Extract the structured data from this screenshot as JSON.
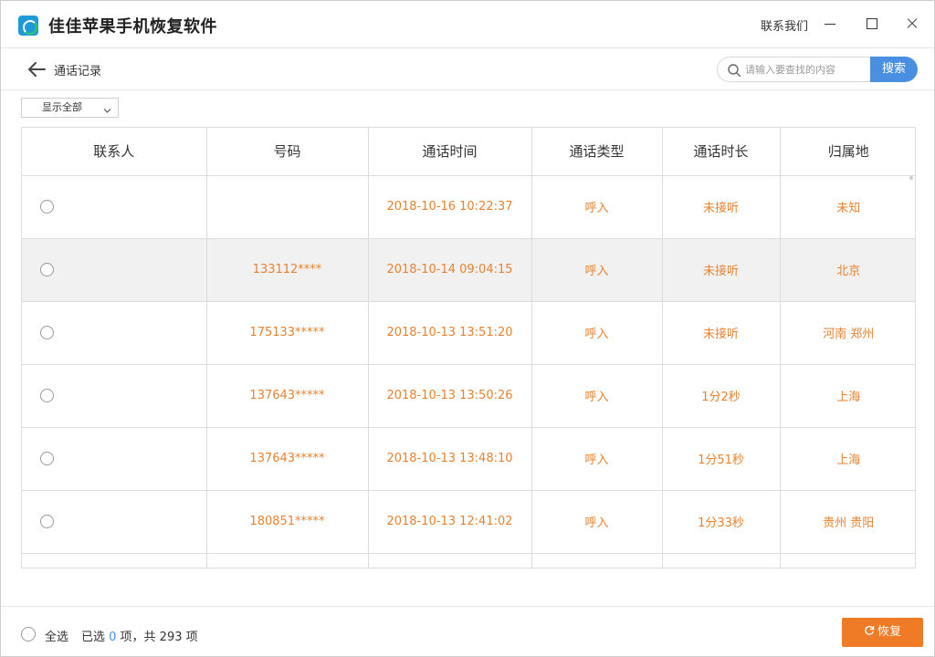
{
  "app": {
    "title": "佳佳苹果手机恢复软件",
    "contact_label": "联系我们"
  },
  "nav": {
    "page_title": "通话记录",
    "search_placeholder": "请输入要查找的内容",
    "search_label": "搜索"
  },
  "filter": {
    "selected": "显示全部"
  },
  "table": {
    "headers": [
      "联系人",
      "号码",
      "通话时间",
      "通话类型",
      "通话时长",
      "归属地"
    ],
    "rows": [
      {
        "contact": "",
        "number": "",
        "time": "2018-10-16 10:22:37",
        "type": "呼入",
        "duration": "未接听",
        "location": "未知"
      },
      {
        "contact": "",
        "number": "133112****",
        "time": "2018-10-14 09:04:15",
        "type": "呼入",
        "duration": "未接听",
        "location": "北京"
      },
      {
        "contact": "",
        "number": "175133*****",
        "time": "2018-10-13 13:51:20",
        "type": "呼入",
        "duration": "未接听",
        "location": "河南 郑州"
      },
      {
        "contact": "",
        "number": "137643*****",
        "time": "2018-10-13 13:50:26",
        "type": "呼入",
        "duration": "1分2秒",
        "location": "上海"
      },
      {
        "contact": "",
        "number": "137643*****",
        "time": "2018-10-13 13:48:10",
        "type": "呼入",
        "duration": "1分51秒",
        "location": "上海"
      },
      {
        "contact": "",
        "number": "180851*****",
        "time": "2018-10-13 12:41:02",
        "type": "呼入",
        "duration": "1分33秒",
        "location": "贵州 贵阳"
      }
    ]
  },
  "footer": {
    "select_all_label": "全选",
    "selected_prefix": "已选 ",
    "selected_count": "0",
    "selected_suffix": " 项，共 293 项",
    "restore_label": "恢复"
  },
  "colors": {
    "accent_blue": "#4a90e2",
    "accent_orange": "#f07b26",
    "cell_text": "#e8822e"
  }
}
